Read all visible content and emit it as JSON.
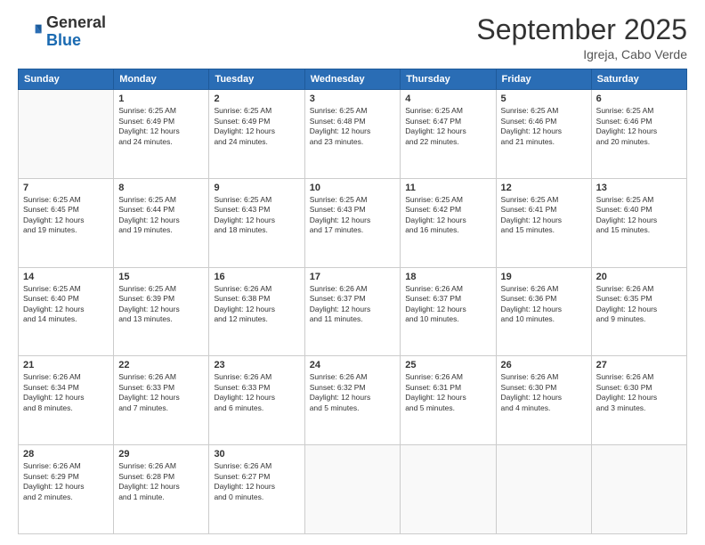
{
  "logo": {
    "general": "General",
    "blue": "Blue"
  },
  "header": {
    "title": "September 2025",
    "subtitle": "Igreja, Cabo Verde"
  },
  "weekdays": [
    "Sunday",
    "Monday",
    "Tuesday",
    "Wednesday",
    "Thursday",
    "Friday",
    "Saturday"
  ],
  "weeks": [
    [
      {
        "day": "",
        "info": ""
      },
      {
        "day": "1",
        "info": "Sunrise: 6:25 AM\nSunset: 6:49 PM\nDaylight: 12 hours\nand 24 minutes."
      },
      {
        "day": "2",
        "info": "Sunrise: 6:25 AM\nSunset: 6:49 PM\nDaylight: 12 hours\nand 24 minutes."
      },
      {
        "day": "3",
        "info": "Sunrise: 6:25 AM\nSunset: 6:48 PM\nDaylight: 12 hours\nand 23 minutes."
      },
      {
        "day": "4",
        "info": "Sunrise: 6:25 AM\nSunset: 6:47 PM\nDaylight: 12 hours\nand 22 minutes."
      },
      {
        "day": "5",
        "info": "Sunrise: 6:25 AM\nSunset: 6:46 PM\nDaylight: 12 hours\nand 21 minutes."
      },
      {
        "day": "6",
        "info": "Sunrise: 6:25 AM\nSunset: 6:46 PM\nDaylight: 12 hours\nand 20 minutes."
      }
    ],
    [
      {
        "day": "7",
        "info": "Sunrise: 6:25 AM\nSunset: 6:45 PM\nDaylight: 12 hours\nand 19 minutes."
      },
      {
        "day": "8",
        "info": "Sunrise: 6:25 AM\nSunset: 6:44 PM\nDaylight: 12 hours\nand 19 minutes."
      },
      {
        "day": "9",
        "info": "Sunrise: 6:25 AM\nSunset: 6:43 PM\nDaylight: 12 hours\nand 18 minutes."
      },
      {
        "day": "10",
        "info": "Sunrise: 6:25 AM\nSunset: 6:43 PM\nDaylight: 12 hours\nand 17 minutes."
      },
      {
        "day": "11",
        "info": "Sunrise: 6:25 AM\nSunset: 6:42 PM\nDaylight: 12 hours\nand 16 minutes."
      },
      {
        "day": "12",
        "info": "Sunrise: 6:25 AM\nSunset: 6:41 PM\nDaylight: 12 hours\nand 15 minutes."
      },
      {
        "day": "13",
        "info": "Sunrise: 6:25 AM\nSunset: 6:40 PM\nDaylight: 12 hours\nand 15 minutes."
      }
    ],
    [
      {
        "day": "14",
        "info": "Sunrise: 6:25 AM\nSunset: 6:40 PM\nDaylight: 12 hours\nand 14 minutes."
      },
      {
        "day": "15",
        "info": "Sunrise: 6:25 AM\nSunset: 6:39 PM\nDaylight: 12 hours\nand 13 minutes."
      },
      {
        "day": "16",
        "info": "Sunrise: 6:26 AM\nSunset: 6:38 PM\nDaylight: 12 hours\nand 12 minutes."
      },
      {
        "day": "17",
        "info": "Sunrise: 6:26 AM\nSunset: 6:37 PM\nDaylight: 12 hours\nand 11 minutes."
      },
      {
        "day": "18",
        "info": "Sunrise: 6:26 AM\nSunset: 6:37 PM\nDaylight: 12 hours\nand 10 minutes."
      },
      {
        "day": "19",
        "info": "Sunrise: 6:26 AM\nSunset: 6:36 PM\nDaylight: 12 hours\nand 10 minutes."
      },
      {
        "day": "20",
        "info": "Sunrise: 6:26 AM\nSunset: 6:35 PM\nDaylight: 12 hours\nand 9 minutes."
      }
    ],
    [
      {
        "day": "21",
        "info": "Sunrise: 6:26 AM\nSunset: 6:34 PM\nDaylight: 12 hours\nand 8 minutes."
      },
      {
        "day": "22",
        "info": "Sunrise: 6:26 AM\nSunset: 6:33 PM\nDaylight: 12 hours\nand 7 minutes."
      },
      {
        "day": "23",
        "info": "Sunrise: 6:26 AM\nSunset: 6:33 PM\nDaylight: 12 hours\nand 6 minutes."
      },
      {
        "day": "24",
        "info": "Sunrise: 6:26 AM\nSunset: 6:32 PM\nDaylight: 12 hours\nand 5 minutes."
      },
      {
        "day": "25",
        "info": "Sunrise: 6:26 AM\nSunset: 6:31 PM\nDaylight: 12 hours\nand 5 minutes."
      },
      {
        "day": "26",
        "info": "Sunrise: 6:26 AM\nSunset: 6:30 PM\nDaylight: 12 hours\nand 4 minutes."
      },
      {
        "day": "27",
        "info": "Sunrise: 6:26 AM\nSunset: 6:30 PM\nDaylight: 12 hours\nand 3 minutes."
      }
    ],
    [
      {
        "day": "28",
        "info": "Sunrise: 6:26 AM\nSunset: 6:29 PM\nDaylight: 12 hours\nand 2 minutes."
      },
      {
        "day": "29",
        "info": "Sunrise: 6:26 AM\nSunset: 6:28 PM\nDaylight: 12 hours\nand 1 minute."
      },
      {
        "day": "30",
        "info": "Sunrise: 6:26 AM\nSunset: 6:27 PM\nDaylight: 12 hours\nand 0 minutes."
      },
      {
        "day": "",
        "info": ""
      },
      {
        "day": "",
        "info": ""
      },
      {
        "day": "",
        "info": ""
      },
      {
        "day": "",
        "info": ""
      }
    ]
  ]
}
